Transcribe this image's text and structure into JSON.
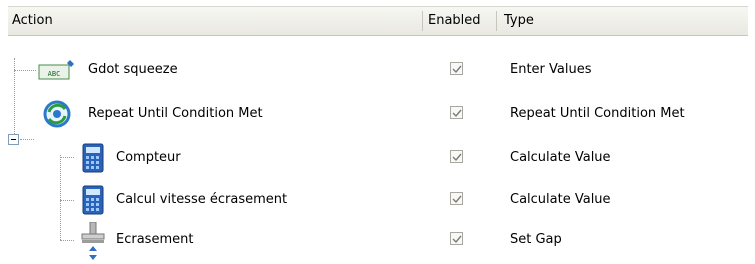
{
  "columns": {
    "action": "Action",
    "enabled": "Enabled",
    "type": "Type"
  },
  "rows": [
    {
      "label": "Gdot squeeze",
      "enabled": true,
      "type": "Enter Values",
      "icon": "enter-values-icon"
    },
    {
      "label": "Repeat Until Condition Met",
      "enabled": true,
      "type": "Repeat Until Condition Met",
      "icon": "repeat-loop-icon"
    },
    {
      "label": "Compteur",
      "enabled": true,
      "type": "Calculate Value",
      "icon": "calculator-icon"
    },
    {
      "label": "Calcul vitesse écrasement",
      "enabled": true,
      "type": "Calculate Value",
      "icon": "calculator-icon"
    },
    {
      "label": "Ecrasement",
      "enabled": true,
      "type": "Set Gap",
      "icon": "set-gap-icon"
    }
  ],
  "icon_text": {
    "enter_values": "ABC"
  }
}
